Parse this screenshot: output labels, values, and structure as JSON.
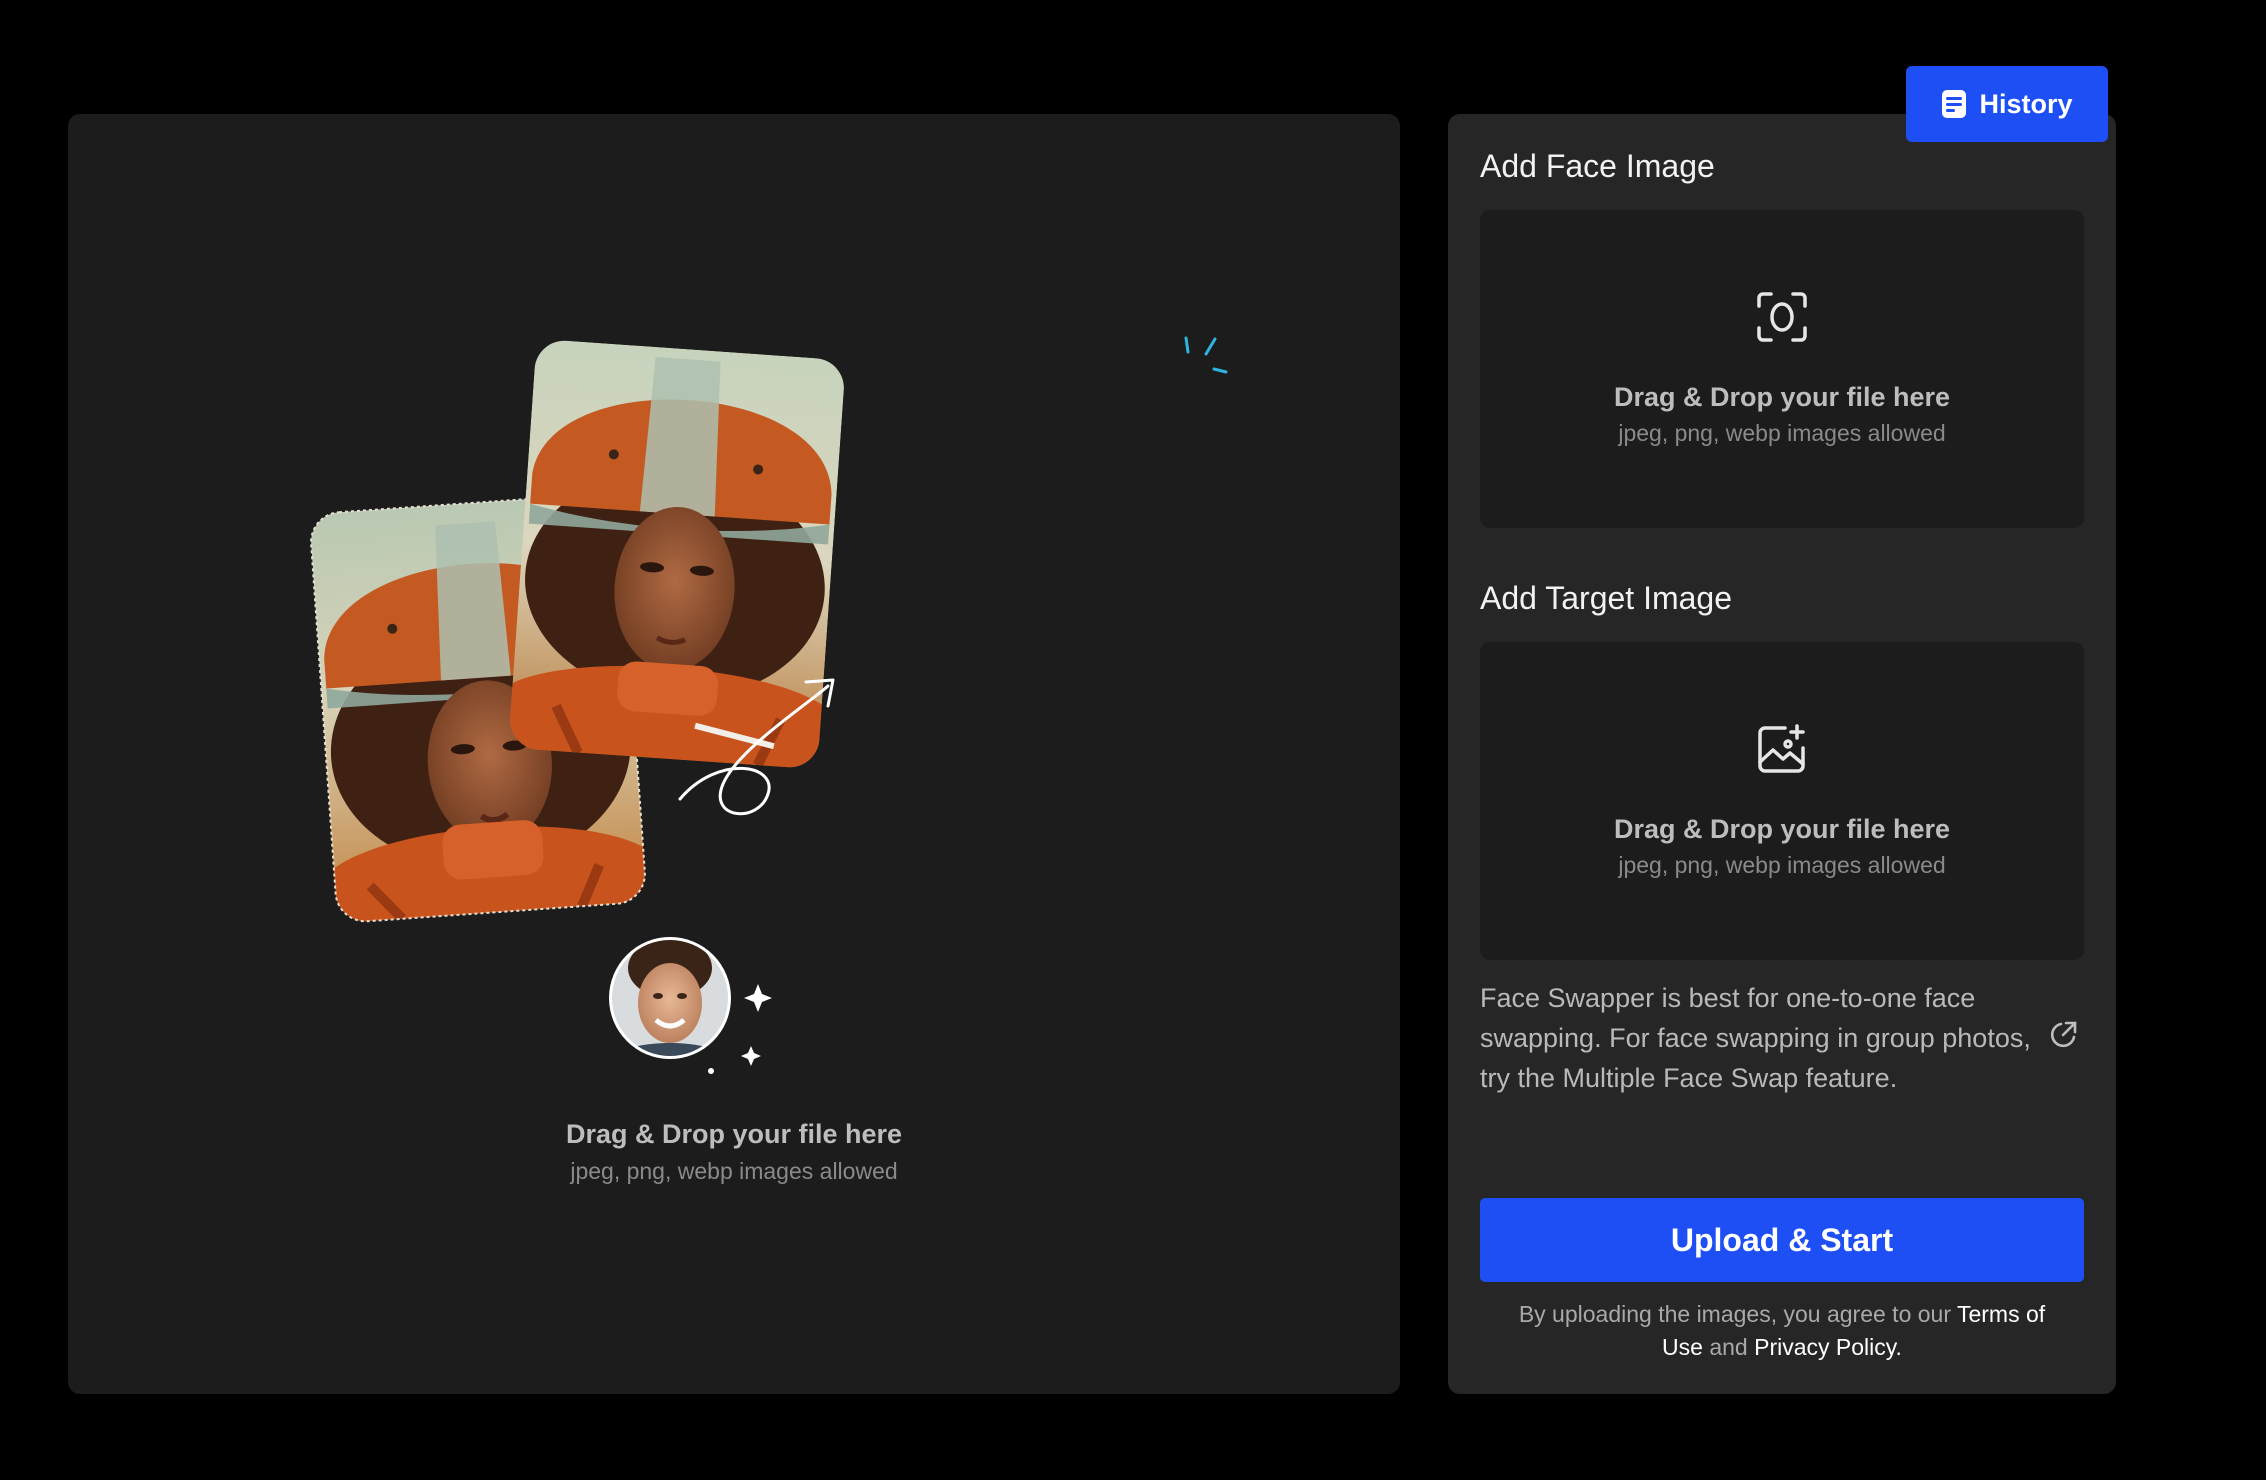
{
  "header": {
    "history_label": "History",
    "history_icon": "history-icon"
  },
  "preview": {
    "drop_title": "Drag & Drop your file here",
    "drop_subtitle": "jpeg, png, webp images allowed",
    "illustration": "face-swap-example"
  },
  "face_section": {
    "title": "Add Face Image",
    "icon": "face-scan-icon",
    "drop_title": "Drag & Drop your file here",
    "drop_subtitle": "jpeg, png, webp images allowed"
  },
  "target_section": {
    "title": "Add Target Image",
    "icon": "image-add-icon",
    "drop_title": "Drag & Drop your file here",
    "drop_subtitle": "jpeg, png, webp images allowed"
  },
  "info": {
    "text": "Face Swapper is best for one-to-one face swapping. For face swapping in group photos, try the Multiple Face Swap feature.",
    "icon": "external-link-icon"
  },
  "actions": {
    "upload_label": "Upload & Start"
  },
  "legal": {
    "prefix": "By uploading the images, you agree to our ",
    "terms_label": "Terms of Use",
    "and": " and ",
    "privacy_label": "Privacy Policy."
  },
  "colors": {
    "background": "#000000",
    "panel": "#1c1c1c",
    "sidebar": "#262626",
    "accent": "#1d4ff5",
    "outfit_orange": "#c9531d",
    "sparkle_cyan": "#2fb4e0"
  }
}
